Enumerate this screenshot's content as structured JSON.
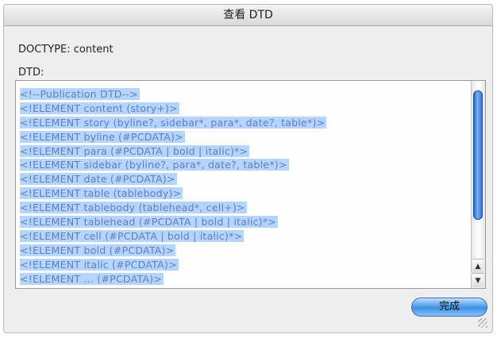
{
  "window": {
    "title": "查看 DTD"
  },
  "doctype_label": "DOCTYPE: content",
  "dtd_label": "DTD:",
  "dtd_lines": [
    "<!--Publication DTD-->",
    "<!ELEMENT content (story+)>",
    "<!ELEMENT story (byline?, sidebar*, para*, date?, table*)>",
    "<!ELEMENT byline (#PCDATA)>",
    "<!ELEMENT para (#PCDATA | bold | italic)*>",
    "<!ELEMENT sidebar (byline?, para*, date?, table*)>",
    "<!ELEMENT date (#PCDATA)>",
    "<!ELEMENT table (tablebody)>",
    "<!ELEMENT tablebody (tablehead*, cell+)>",
    "<!ELEMENT tablehead (#PCDATA | bold | italic)*>",
    "<!ELEMENT cell (#PCDATA | bold | italic)*>",
    "<!ELEMENT bold (#PCDATA)>",
    "<!ELEMENT italic (#PCDATA)>",
    "<!ELEMENT ... (#PCDATA)>"
  ],
  "done_button": "完成",
  "colors": {
    "selection": "#b5d5ff",
    "text": "#5d7fbf",
    "accent": "#3d8fe5"
  },
  "icons": {
    "scroll_up": "up-arrow-icon",
    "scroll_down": "down-arrow-icon",
    "resize": "resize-grip-icon"
  }
}
